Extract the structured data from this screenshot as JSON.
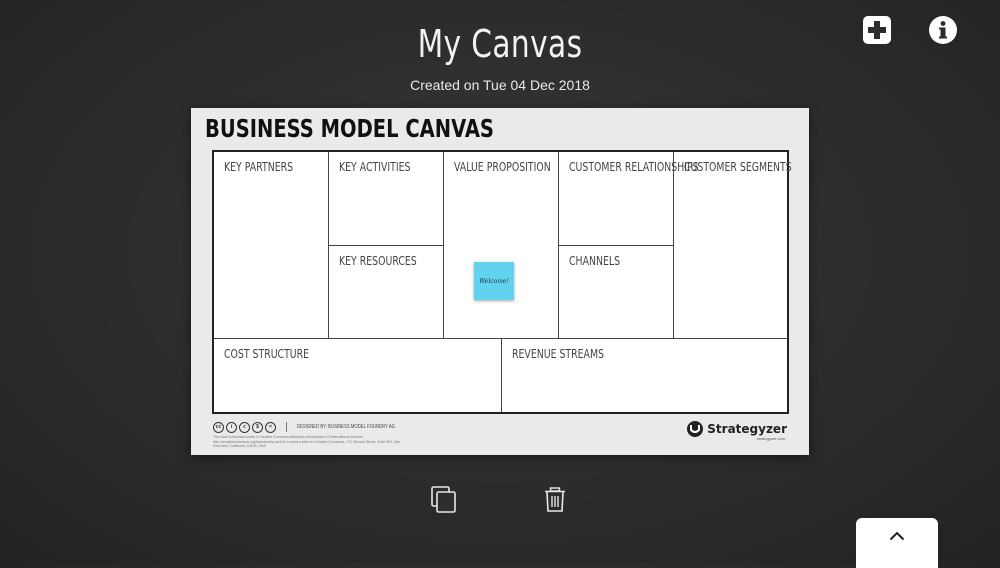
{
  "header": {
    "title": "My Canvas",
    "subtitle": "Created on Tue 04 Dec 2018",
    "add_icon": "plus-icon",
    "info_icon": "info-icon"
  },
  "canvas": {
    "heading": "BUSINESS MODEL CANVAS",
    "blocks": {
      "key_partners": "KEY PARTNERS",
      "key_activities": "KEY ACTIVITIES",
      "key_resources": "KEY RESOURCES",
      "value_proposition": "VALUE PROPOSITION",
      "customer_relationships": "CUSTOMER RELATIONSHIPS",
      "channels": "CHANNELS",
      "customer_segments": "CUSTOMER SEGMENTS",
      "cost_structure": "COST STRUCTURE",
      "revenue_streams": "REVENUE STREAMS"
    },
    "sticky_note": {
      "text": "Welcome!",
      "color": "#62d3ee"
    },
    "footer": {
      "designed_by": "DESIGNED BY: BUSINESS MODEL FOUNDRY AG",
      "license": "This work is licensed under a Creative Commons Attribution-ShareAlike 4.0 International License. http://creativecommons.org/licenses/by-sa/4.0/ or send a letter to Creative Commons, 171 Second Street, Suite 300, San Francisco, California, 94105, USA.",
      "brand": "Strategyzer",
      "brand_url": "strategyzer.com"
    }
  },
  "toolbar": {
    "duplicate_icon": "duplicate-icon",
    "delete_icon": "trash-icon",
    "drawer_icon": "chevron-up-icon"
  },
  "colors": {
    "background": "#2c2c2c",
    "accent": "#62d3ee"
  }
}
